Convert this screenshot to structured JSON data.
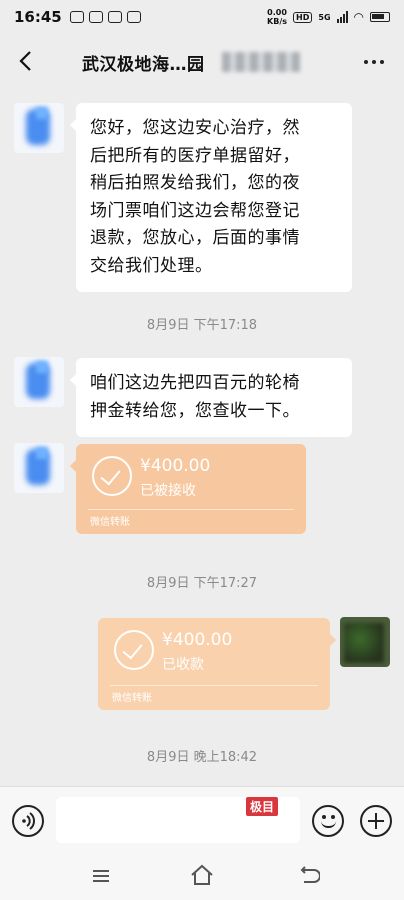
{
  "status_bar": {
    "time": "16:45",
    "net_speed_value": "0.00",
    "net_speed_unit": "KB/s",
    "hd_label": "HD",
    "network": "5G"
  },
  "header": {
    "title": "武汉极地海…园"
  },
  "messages": {
    "msg1": {
      "lines": [
        "您好，您这边安心治疗，然",
        "后把所有的医疗单据留好，",
        "稍后拍照发给我们，您的夜",
        "场门票咱们这边会帮您登记",
        "退款，您放心，后面的事情",
        "交给我们处理。"
      ]
    },
    "ts1": "8月9日 下午17:18",
    "msg2": {
      "lines": [
        "咱们这边先把四百元的轮椅",
        "押金转给您，您查收一下。"
      ]
    },
    "transfer1": {
      "amount": "¥400.00",
      "status": "已被接收",
      "label": "微信转账"
    },
    "ts2": "8月9日 下午17:27",
    "transfer2": {
      "amount": "¥400.00",
      "status": "已收款",
      "label": "微信转账"
    },
    "ts3": "8月9日 晚上18:42"
  },
  "input_bar": {
    "watermark": "极目"
  },
  "colors": {
    "background": "#ededed",
    "bubble": "#ffffff",
    "transfer": "#f7c8a0"
  }
}
